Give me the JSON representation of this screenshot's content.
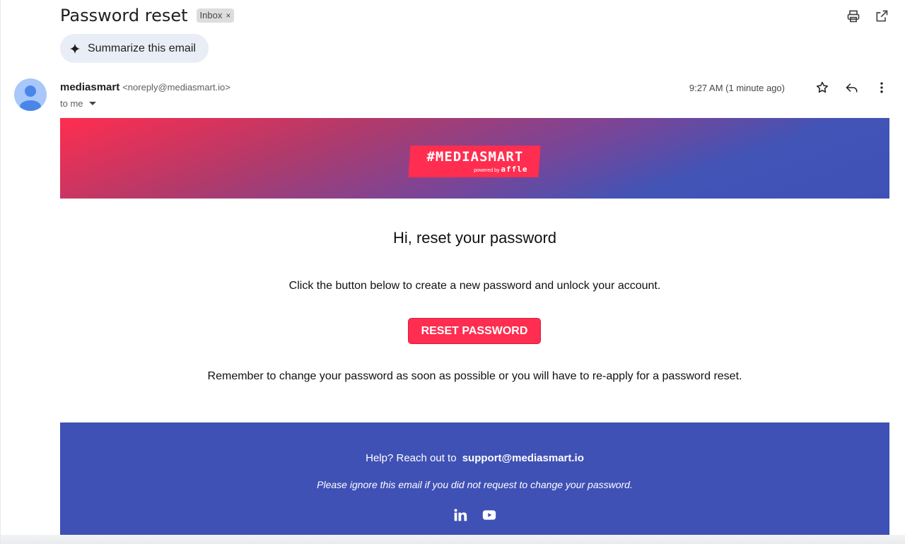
{
  "email": {
    "subject": "Password reset",
    "label": "Inbox",
    "label_remove": "×",
    "summarize_label": "Summarize this email",
    "sender_name": "mediasmart",
    "sender_email": "<noreply@mediasmart.io>",
    "recipient": "to me",
    "time": "9:27 AM (1 minute ago)"
  },
  "logo": {
    "main": "#MEDIASMART",
    "powered_by": "powered by",
    "partner": "affle"
  },
  "body": {
    "greeting": "Hi, reset your password",
    "instruction": "Click the button below to create a new password and unlock your account.",
    "button_label": "RESET PASSWORD",
    "reminder": "Remember to change your password as soon as possible or you will have to re-apply for a password reset."
  },
  "footer": {
    "help_text": "Help? Reach out to",
    "support_email": "support@mediasmart.io",
    "ignore_text": "Please ignore this email if you did not request to change your password."
  },
  "icons": {
    "print": "print-icon",
    "open_new_window": "open-in-new-window-icon",
    "sparkle": "sparkle-icon",
    "star": "star-icon",
    "reply": "reply-icon",
    "more": "more-vertical-icon",
    "linkedin": "linkedin-icon",
    "youtube": "youtube-icon"
  },
  "colors": {
    "brand_red": "#ff2d4f",
    "brand_blue": "#3f51b5",
    "summarize_chip": "#e9eef6"
  }
}
